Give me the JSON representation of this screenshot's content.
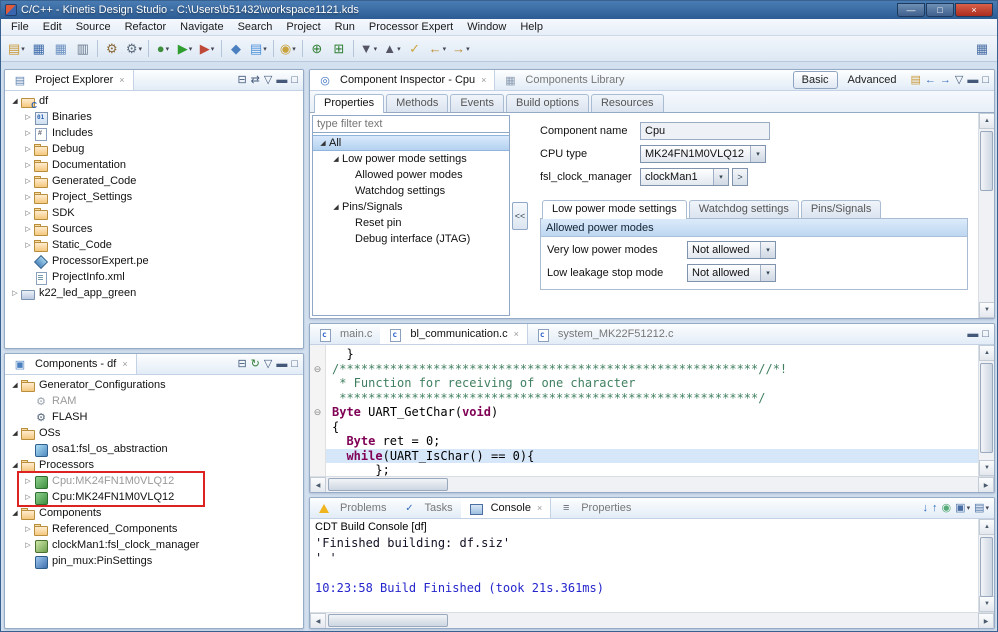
{
  "window": {
    "title": "C/C++ - Kinetis Design Studio - C:\\Users\\b51432\\workspace1121.kds"
  },
  "icons": {
    "close": "×",
    "dropdown": "▾",
    "menu": "▽",
    "collapsed": "▷",
    "expanded": "◢",
    "fold": "⊖",
    "up": "▲",
    "down": "▼",
    "left": "◀",
    "right": "▶",
    "win_min": "—",
    "win_max": "□"
  },
  "colors": {
    "titlebar_blue": "#2c5c93",
    "selection_blue": "#b4d2f0",
    "annotation_red": "#dd2222",
    "comment_green": "#3f7f5f",
    "keyword_purple": "#7f0055",
    "console_info_blue": "#2525cd",
    "highlight_line": "#d7e7fa"
  },
  "menubar": [
    "File",
    "Edit",
    "Source",
    "Refactor",
    "Navigate",
    "Search",
    "Project",
    "Run",
    "Processor Expert",
    "Window",
    "Help"
  ],
  "toolbar": [
    {
      "name": "new",
      "glyph": "▤",
      "color": "#c89632",
      "dd": true
    },
    {
      "name": "save",
      "glyph": "▦",
      "color": "#3c69a8"
    },
    {
      "name": "save-all",
      "glyph": "▦",
      "color": "#6a8fc0"
    },
    {
      "name": "print",
      "glyph": "▥",
      "color": "#68788c"
    },
    {
      "sep": true
    },
    {
      "name": "build",
      "glyph": "⚙",
      "color": "#8a6a3a"
    },
    {
      "name": "build-config",
      "glyph": "⚙",
      "color": "#5a6b7d",
      "dd": true
    },
    {
      "sep": true
    },
    {
      "name": "debug",
      "glyph": "●",
      "color": "#3e8e3e",
      "dd": true
    },
    {
      "name": "run",
      "glyph": "▶",
      "color": "#2f9e2f",
      "dd": true
    },
    {
      "name": "external-tools",
      "glyph": "▶",
      "color": "#c04a3a",
      "dd": true
    },
    {
      "sep": true
    },
    {
      "name": "new-cpp-class",
      "glyph": "◆",
      "color": "#4a7fc0"
    },
    {
      "name": "new-c-file",
      "glyph": "▤",
      "color": "#4a90d9",
      "dd": true
    },
    {
      "sep": true
    },
    {
      "name": "search",
      "glyph": "◉",
      "color": "#c8a23d",
      "dd": true
    },
    {
      "sep": true
    },
    {
      "name": "pe-generate-code",
      "glyph": "⊕",
      "color": "#2e7d32"
    },
    {
      "name": "pe-components",
      "glyph": "⊞",
      "color": "#2e7d32"
    },
    {
      "sep": true
    },
    {
      "name": "next-annotation",
      "glyph": "▼",
      "color": "#556",
      "dd": true
    },
    {
      "name": "previous-annotation",
      "glyph": "▲",
      "color": "#556",
      "dd": true
    },
    {
      "name": "last-edit-location",
      "glyph": "✓",
      "color": "#caa53d"
    },
    {
      "name": "back",
      "glyph": "←",
      "color": "#b98c2e",
      "dd": true
    },
    {
      "name": "forward",
      "glyph": "→",
      "color": "#b98c2e",
      "dd": true
    },
    {
      "name": "open-perspective",
      "glyph": "▦",
      "color": "#4a6fa5",
      "right": true
    }
  ],
  "project_explorer": {
    "tabs": [
      {
        "label": "Project Explorer",
        "icon": "explorer",
        "active": true,
        "closable": true
      }
    ],
    "buttons": [
      {
        "name": "collapse-all",
        "glyph": "⊟"
      },
      {
        "name": "link-with-editor",
        "glyph": "⇄"
      },
      {
        "name": "view-menu",
        "glyph": "▽"
      },
      {
        "name": "minimize",
        "glyph": "▬"
      },
      {
        "name": "maximize",
        "glyph": "□"
      }
    ],
    "tree": [
      {
        "label": "df",
        "depth": 0,
        "arrow": "down",
        "icon": "project"
      },
      {
        "label": "Binaries",
        "depth": 1,
        "arrow": "right",
        "icon": "binaries"
      },
      {
        "label": "Includes",
        "depth": 1,
        "arrow": "right",
        "icon": "includes"
      },
      {
        "label": "Debug",
        "depth": 1,
        "arrow": "right",
        "icon": "folder"
      },
      {
        "label": "Documentation",
        "depth": 1,
        "arrow": "right",
        "icon": "folder"
      },
      {
        "label": "Generated_Code",
        "depth": 1,
        "arrow": "right",
        "icon": "folder"
      },
      {
        "label": "Project_Settings",
        "depth": 1,
        "arrow": "right",
        "icon": "folder"
      },
      {
        "label": "SDK",
        "depth": 1,
        "arrow": "right",
        "icon": "folder"
      },
      {
        "label": "Sources",
        "depth": 1,
        "arrow": "right",
        "icon": "folder"
      },
      {
        "label": "Static_Code",
        "depth": 1,
        "arrow": "right",
        "icon": "folder"
      },
      {
        "label": "ProcessorExpert.pe",
        "depth": 1,
        "arrow": "none",
        "icon": "pe-file"
      },
      {
        "label": "ProjectInfo.xml",
        "depth": 1,
        "arrow": "none",
        "icon": "xml-file"
      },
      {
        "label": "k22_led_app_green",
        "depth": 0,
        "arrow": "right",
        "icon": "project-closed"
      }
    ]
  },
  "components": {
    "tabs": [
      {
        "label": "Components - df",
        "icon": "components-view",
        "active": true,
        "closable": true
      }
    ],
    "buttons": [
      {
        "name": "collapse-all",
        "glyph": "⊟"
      },
      {
        "name": "code-generation",
        "glyph": "↻",
        "color": "#2e7d32"
      },
      {
        "name": "view-menu",
        "glyph": "▽"
      },
      {
        "name": "minimize",
        "glyph": "▬"
      },
      {
        "name": "maximize",
        "glyph": "□"
      }
    ],
    "tree": [
      {
        "label": "Generator_Configurations",
        "depth": 0,
        "arrow": "down",
        "icon": "folder"
      },
      {
        "label": "RAM",
        "depth": 1,
        "arrow": "none",
        "icon": "gear-gray",
        "dim": true
      },
      {
        "label": "FLASH",
        "depth": 1,
        "arrow": "none",
        "icon": "gear"
      },
      {
        "label": "OSs",
        "depth": 0,
        "arrow": "down",
        "icon": "folder"
      },
      {
        "label": "osa1:fsl_os_abstraction",
        "depth": 1,
        "arrow": "none",
        "icon": "component-os"
      },
      {
        "label": "Processors",
        "depth": 0,
        "arrow": "down",
        "icon": "folder"
      },
      {
        "label": "Cpu:MK24FN1M0VLQ12",
        "depth": 1,
        "arrow": "right",
        "icon": "chip",
        "dim": true
      },
      {
        "label": "Cpu:MK24FN1M0VLQ12",
        "depth": 1,
        "arrow": "right",
        "icon": "chip"
      },
      {
        "label": "Components",
        "depth": 0,
        "arrow": "down",
        "icon": "folder"
      },
      {
        "label": "Referenced_Components",
        "depth": 1,
        "arrow": "right",
        "icon": "folder"
      },
      {
        "label": "clockMan1:fsl_clock_manager",
        "depth": 1,
        "arrow": "right",
        "icon": "component"
      },
      {
        "label": "pin_mux:PinSettings",
        "depth": 1,
        "arrow": "none",
        "icon": "chip-blue"
      }
    ]
  },
  "inspector": {
    "tabs": [
      {
        "label": "Component Inspector - Cpu",
        "icon": "inspector",
        "active": true,
        "closable": true
      },
      {
        "label": "Components Library",
        "icon": "library",
        "active": false
      }
    ],
    "basic_label": "Basic",
    "advanced_label": "Advanced",
    "buttons": [
      {
        "name": "new-wizard",
        "glyph": "▤",
        "color": "#c89632"
      },
      {
        "name": "back",
        "glyph": "←",
        "color": "#3a6fbf"
      },
      {
        "name": "forward",
        "glyph": "→",
        "color": "#3a6fbf"
      },
      {
        "name": "view-menu",
        "glyph": "▽"
      },
      {
        "name": "minimize",
        "glyph": "▬"
      },
      {
        "name": "maximize",
        "glyph": "□"
      }
    ],
    "prop_tabs": [
      "Properties",
      "Methods",
      "Events",
      "Build options",
      "Resources"
    ],
    "active_prop_tab": "Properties",
    "filter_placeholder": "type filter text",
    "tree": [
      {
        "label": "All",
        "depth": 0,
        "arrow": "down",
        "selected": true
      },
      {
        "label": "Low power mode settings",
        "depth": 1,
        "arrow": "down"
      },
      {
        "label": "Allowed power modes",
        "depth": 2,
        "arrow": "none"
      },
      {
        "label": "Watchdog settings",
        "depth": 2,
        "arrow": "none"
      },
      {
        "label": "Pins/Signals",
        "depth": 1,
        "arrow": "down"
      },
      {
        "label": "Reset pin",
        "depth": 2,
        "arrow": "none"
      },
      {
        "label": "Debug interface (JTAG)",
        "depth": 2,
        "arrow": "none"
      }
    ],
    "collapse_button": "<<",
    "fields": [
      {
        "label": "Component name",
        "value": "Cpu",
        "type": "text"
      },
      {
        "label": "CPU type",
        "value": "MK24FN1M0VLQ12",
        "type": "select"
      },
      {
        "label": "fsl_clock_manager",
        "value": "clockMan1",
        "type": "select",
        "extra": ">"
      }
    ],
    "subtabs": [
      "Low power mode settings",
      "Watchdog settings",
      "Pins/Signals"
    ],
    "active_subtab": "Low power mode settings",
    "group_header": "Allowed power modes",
    "settings": [
      {
        "label": "Very low power modes",
        "value": "Not allowed"
      },
      {
        "label": "Low leakage stop mode",
        "value": "Not allowed"
      }
    ]
  },
  "editor": {
    "tabs": [
      {
        "label": "main.c",
        "icon": "cfile",
        "active": false
      },
      {
        "label": "bl_communication.c",
        "icon": "cfile",
        "active": true,
        "closable": true
      },
      {
        "label": "system_MK22F51212.c",
        "icon": "cfile",
        "active": false
      }
    ],
    "buttons": [
      {
        "name": "minimize",
        "glyph": "▬"
      },
      {
        "name": "maximize",
        "glyph": "□"
      }
    ],
    "code": [
      {
        "segs": [
          [
            "p",
            "  }"
          ]
        ]
      },
      {
        "fold": true,
        "segs": [
          [
            "c",
            "/**********************************************************//*!"
          ]
        ]
      },
      {
        "segs": [
          [
            "c",
            " * Function for receiving of one character"
          ]
        ]
      },
      {
        "segs": [
          [
            "c",
            " **********************************************************/"
          ]
        ]
      },
      {
        "fold": true,
        "segs": [
          [
            "t",
            "Byte"
          ],
          [
            "p",
            " "
          ],
          [
            "f",
            "UART_GetChar"
          ],
          [
            "p",
            "("
          ],
          [
            "k",
            "void"
          ],
          [
            "p",
            ")"
          ]
        ]
      },
      {
        "segs": [
          [
            "p",
            "{"
          ]
        ]
      },
      {
        "segs": [
          [
            "p",
            "  "
          ],
          [
            "t",
            "Byte"
          ],
          [
            "p",
            " ret = "
          ],
          [
            "n",
            "0"
          ],
          [
            "p",
            ";"
          ]
        ]
      },
      {
        "hl": true,
        "segs": [
          [
            "p",
            "  "
          ],
          [
            "k",
            "while"
          ],
          [
            "p",
            "("
          ],
          [
            "f",
            "UART_IsChar"
          ],
          [
            "p",
            "() == "
          ],
          [
            "n",
            "0"
          ],
          [
            "p",
            "){"
          ]
        ]
      },
      {
        "segs": [
          [
            "p",
            "      };"
          ]
        ]
      }
    ]
  },
  "console": {
    "tabs": [
      {
        "label": "Problems",
        "icon": "problems",
        "active": false
      },
      {
        "label": "Tasks",
        "icon": "tasks",
        "active": false
      },
      {
        "label": "Console",
        "icon": "console-view",
        "active": true,
        "closable": true
      },
      {
        "label": "Properties",
        "icon": "properties",
        "active": false
      }
    ],
    "buttons": [
      {
        "name": "scroll-to-bottom",
        "glyph": "↓",
        "color": "#2f6fbf"
      },
      {
        "name": "scroll-to-top",
        "glyph": "↑",
        "color": "#2f6fbf"
      },
      {
        "name": "pin-console",
        "glyph": "◉",
        "color": "#55aa77"
      },
      {
        "name": "display-selected-console",
        "glyph": "▣",
        "color": "#4a6fa5",
        "dd": true
      },
      {
        "name": "open-console",
        "glyph": "▤",
        "color": "#4a6fa5",
        "dd": true
      }
    ],
    "header": "CDT Build Console [df]",
    "lines": [
      {
        "text": "'Finished building: df.siz'"
      },
      {
        "text": "' '"
      },
      {
        "text": ""
      },
      {
        "text": "10:23:58 Build Finished (took 21s.361ms)",
        "style": "info"
      }
    ]
  }
}
